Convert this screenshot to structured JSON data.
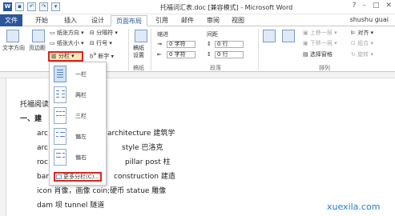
{
  "window": {
    "title": "托福词汇表.doc [兼容模式] - Microsoft Word",
    "user": "shushu guai"
  },
  "tabs": [
    "文件",
    "开始",
    "插入",
    "设计",
    "页面布局",
    "引用",
    "邮件",
    "审阅",
    "视图"
  ],
  "active_tab": "页面布局",
  "ribbon": {
    "text_direction": "文字方向",
    "margins": "页边距",
    "orientation": "纸张方向",
    "size": "纸张大小",
    "columns": "分栏",
    "breaks": "分隔符",
    "line_numbers": "行号",
    "hyphenation": "断字",
    "draft": "稿纸\n设置",
    "draft_group": "稿纸",
    "indent_label": "缩进",
    "spacing_label": "间距",
    "indent_left": "0 字符",
    "indent_right": "0 字符",
    "spacing_before": "0 行",
    "spacing_after": "0 行",
    "paragraph_group": "段落",
    "forward": "上移一层",
    "backward": "下移一层",
    "selection_pane": "选择窗格",
    "align": "对齐",
    "group": "组合",
    "rotate": "旋转",
    "arrange_group": "排列"
  },
  "columns_menu": {
    "items": [
      "一栏",
      "两栏",
      "三栏",
      "偏左",
      "偏右"
    ],
    "more": "更多分栏(C)..."
  },
  "document": {
    "lines": [
      "托福阅读",
      "一、建",
      "architecture  建筑学",
      "style  巴洛克",
      "pillar post  柱",
      "construction  建造",
      "icon 肖像，画像 coin;硬币    statue 雕像",
      "dam  坝    tunnel 隧道"
    ],
    "prefixes": [
      "arc",
      "arc",
      "roc",
      "bar"
    ]
  },
  "watermark": "xuexila.com"
}
